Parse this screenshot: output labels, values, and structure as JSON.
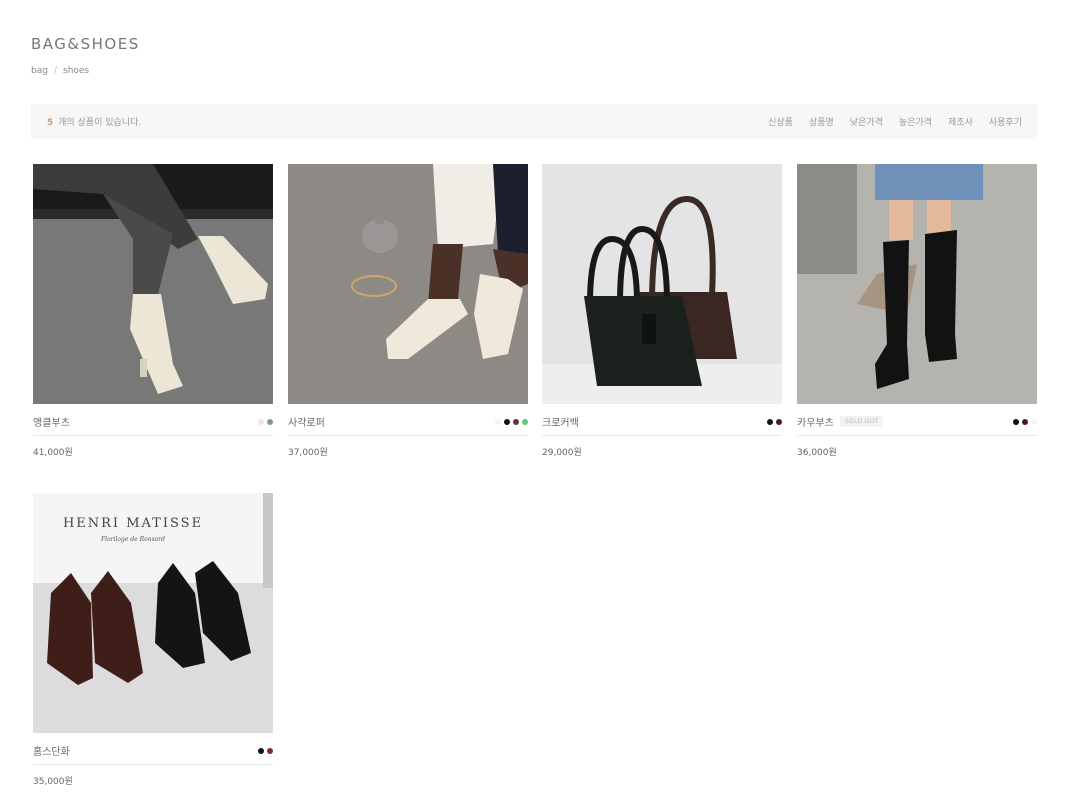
{
  "header": {
    "title": "BAG&SHOES"
  },
  "breadcrumb": {
    "items": [
      "bag",
      "shoes"
    ],
    "separator": "/"
  },
  "toolbar": {
    "count": "5",
    "count_suffix": "개의 상품이 있습니다.",
    "sort_options": [
      "신상품",
      "상품명",
      "낮은가격",
      "높은가격",
      "제조사",
      "사용후기"
    ]
  },
  "colors": {
    "accent": "#c9a080",
    "text": "#555555",
    "toolbar_bg": "#f7f7f7"
  },
  "products": [
    {
      "name": "앵클부츠",
      "price": "41,000원",
      "sold_out": false,
      "swatches": [
        "#e6e6ea",
        "#7e9a86"
      ]
    },
    {
      "name": "사각로퍼",
      "price": "37,000원",
      "sold_out": false,
      "swatches": [
        "#f2f2f2",
        "#111111",
        "#5a3a32",
        "#5cc97a"
      ]
    },
    {
      "name": "크로커백",
      "price": "29,000원",
      "sold_out": false,
      "swatches": [
        "#111111",
        "#4a1e1e"
      ]
    },
    {
      "name": "카우부츠",
      "price": "36,000원",
      "sold_out": true,
      "sold_out_label": "SOLD OUT",
      "swatches": [
        "#111111",
        "#4a1e1e",
        "#f2f2f2"
      ]
    },
    {
      "name": "홈스단화",
      "price": "35,000원",
      "sold_out": false,
      "swatches": [
        "#111111",
        "#7a2e24"
      ],
      "image_text": {
        "line1": "HENRI MATISSE",
        "line2": "Floriloge de Ronsard"
      }
    }
  ]
}
